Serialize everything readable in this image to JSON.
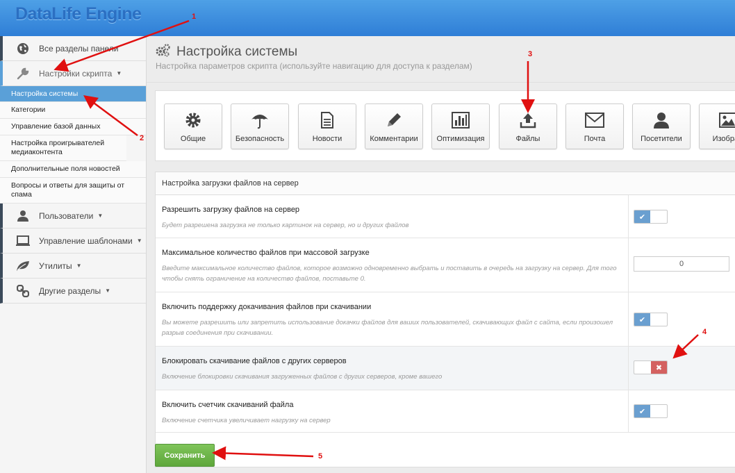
{
  "header": {
    "logo": "DataLife Engine"
  },
  "sidebar": {
    "items": [
      {
        "label": "Все разделы панели",
        "icon": "globe-icon"
      },
      {
        "label": "Настройки скрипта",
        "icon": "wrench-icon"
      },
      {
        "label": "Пользователи",
        "icon": "user-icon"
      },
      {
        "label": "Управление шаблонами",
        "icon": "monitor-icon"
      },
      {
        "label": "Утилиты",
        "icon": "leaf-icon"
      },
      {
        "label": "Другие разделы",
        "icon": "link-icon"
      }
    ],
    "submenu": [
      "Настройка системы",
      "Категории",
      "Управление базой данных",
      "Настройка проигрывателей медиаконтента",
      "Дополнительные поля новостей",
      "Вопросы и ответы для защиты от спама"
    ]
  },
  "page": {
    "title": "Настройка системы",
    "subtitle": "Настройка параметров скрипта (используйте навигацию для доступа к разделам)"
  },
  "tabs": [
    {
      "label": "Общие",
      "icon": "gear-icon"
    },
    {
      "label": "Безопасность",
      "icon": "umbrella-icon"
    },
    {
      "label": "Новости",
      "icon": "document-icon"
    },
    {
      "label": "Комментарии",
      "icon": "pencil-icon"
    },
    {
      "label": "Оптимизация",
      "icon": "bar-chart-icon"
    },
    {
      "label": "Файлы",
      "icon": "upload-icon"
    },
    {
      "label": "Почта",
      "icon": "envelope-icon"
    },
    {
      "label": "Посетители",
      "icon": "user-icon"
    },
    {
      "label": "Изображ",
      "icon": "image-icon"
    }
  ],
  "settings": {
    "header": "Настройка загрузки файлов на сервер",
    "rows": [
      {
        "title": "Разрешить загрузку файлов на сервер",
        "desc": "Будет разрешена загрузка не только картинок на сервер, но и других файлов",
        "control": "toggle",
        "on": true
      },
      {
        "title": "Максимальное количество файлов при массовой загрузке",
        "desc": "Введите максимальное количество файлов, которое возможно одновременно выбрать и поставить в очередь на загрузку на сервер. Для того чтобы снять ограничение на количество файлов, поставьте 0.",
        "control": "input",
        "value": "0"
      },
      {
        "title": "Включить поддержку докачивания файлов при скачивании",
        "desc": "Вы можете разрешить или запретить использование докачки файлов для ваших пользователей, скачивающих файл с сайта, если произошел разрыв соединения при скачивании.",
        "control": "toggle",
        "on": true
      },
      {
        "title": "Блокировать скачивание файлов с других серверов",
        "desc": "Включение блокировки скачивания загруженных файлов с других серверов, кроме вашего",
        "control": "toggle",
        "on": false
      },
      {
        "title": "Включить счетчик скачиваний файла",
        "desc": "Включение счетчика увеличивает нагрузку на сервер",
        "control": "toggle",
        "on": true
      }
    ]
  },
  "save_label": "Сохранить",
  "annotations": [
    "1",
    "2",
    "3",
    "4",
    "5"
  ],
  "colors": {
    "accent": "#5aa0d8",
    "annotation": "#e01010",
    "save": "#6cb348",
    "toggle_on": "#6a9fd0",
    "toggle_off": "#d46160"
  }
}
